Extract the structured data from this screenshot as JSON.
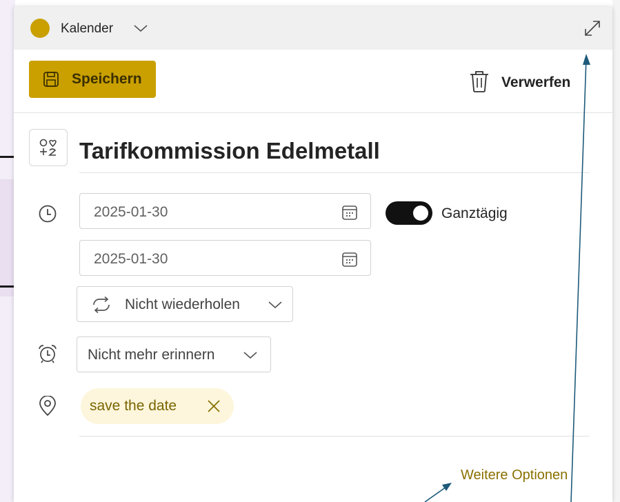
{
  "header": {
    "calendar_label": "Kalender",
    "calendar_color": "#c9a000",
    "chevron_icon": "chevron-down-icon",
    "expand_icon": "expand-icon"
  },
  "toolbar": {
    "save_label": "Speichern",
    "save_icon": "save-icon",
    "discard_label": "Verwerfen",
    "discard_icon": "trash-icon"
  },
  "event": {
    "category_icon": "category-icon",
    "title": "Tarifkommission Edelmetall"
  },
  "time": {
    "icon": "clock-icon",
    "start_date": "2025-01-30",
    "end_date": "2025-01-30",
    "date_picker_icon": "calendar-icon",
    "all_day_label": "Ganztägig",
    "all_day_on": true
  },
  "repeat": {
    "icon": "repeat-icon",
    "label": "Nicht wiederholen"
  },
  "reminder": {
    "icon": "alarm-icon",
    "label": "Nicht mehr erinnern"
  },
  "location": {
    "icon": "location-icon",
    "chip_label": "save the date",
    "remove_icon": "close-icon"
  },
  "footer": {
    "more_options": "Weitere Optionen"
  },
  "colors": {
    "accent": "#c9a000",
    "chip_bg": "#fdf6dc",
    "link": "#8a7000",
    "annotation_arrow": "#1e5a7a"
  }
}
